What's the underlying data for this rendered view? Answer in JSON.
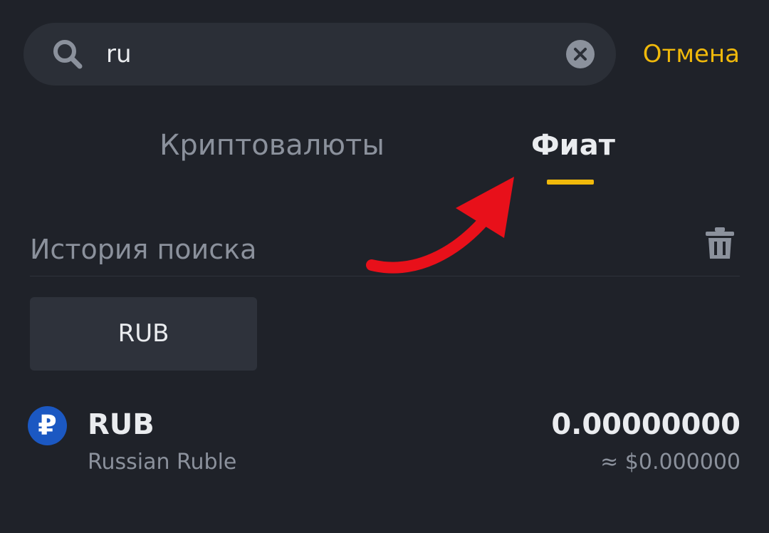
{
  "search": {
    "value": "ru",
    "icon": "search-icon",
    "clear_icon": "clear-icon",
    "cancel_label": "Отмена"
  },
  "tabs": [
    {
      "label": "Криптовалюты",
      "active": false
    },
    {
      "label": "Фиат",
      "active": true
    }
  ],
  "history": {
    "title": "История поиска",
    "delete_icon": "trash-icon",
    "items": [
      "RUB"
    ]
  },
  "results": [
    {
      "icon_symbol": "₽",
      "code": "RUB",
      "name": "Russian Ruble",
      "balance": "0.00000000",
      "usd_value": "≈ $0.000000"
    }
  ],
  "colors": {
    "background": "#1f2229",
    "accent": "#f0b90b",
    "annotation_arrow": "#e8101a",
    "coin_icon": "#1b58c2"
  }
}
